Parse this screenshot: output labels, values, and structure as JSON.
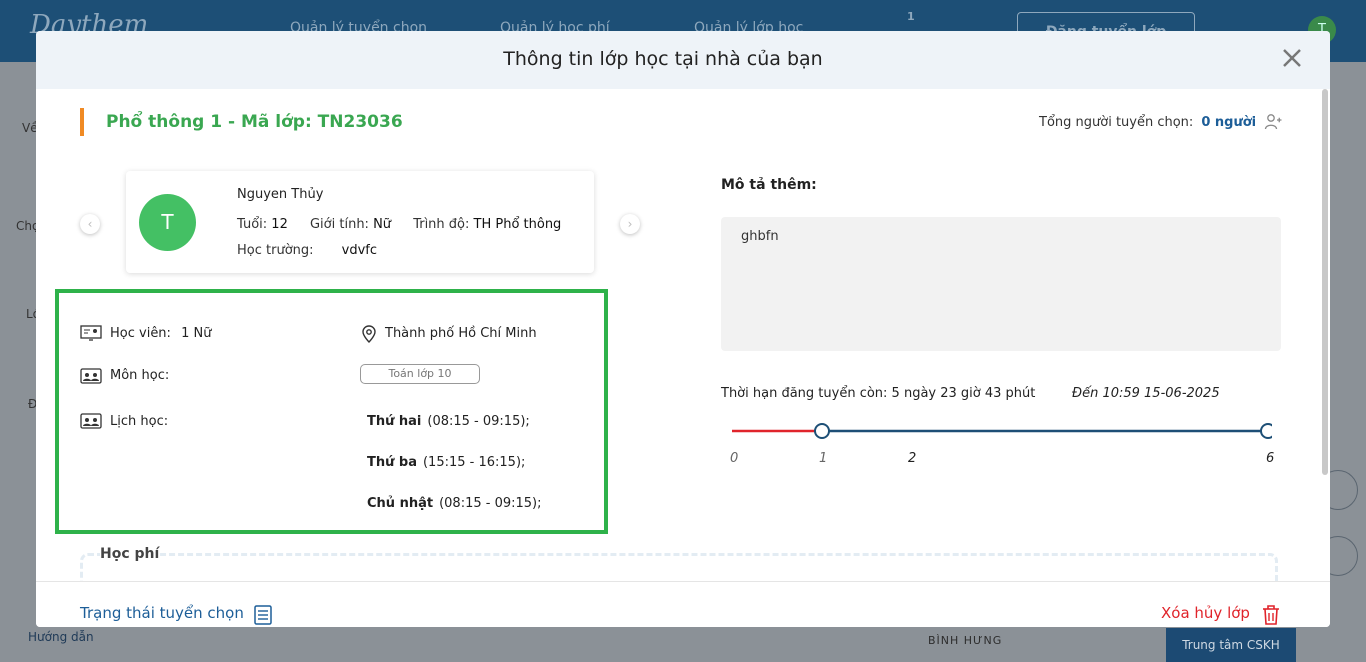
{
  "background": {
    "logo": "Daythem",
    "nav": [
      "Quản lý tuyển chọn",
      "Quản lý học phí",
      "Quản lý lớp học"
    ],
    "notification_count": "1",
    "post_button": "Đăng tuyển lớp",
    "user_initial": "T",
    "side_labels": [
      "Về",
      "Chọ",
      "Lớ",
      "Đ"
    ],
    "help": "Hướng dẫn",
    "map_label": "BÌNH HƯNG",
    "cskh": "Trung tâm CSKH"
  },
  "modal": {
    "title": "Thông tin lớp học tại nhà của bạn",
    "class_title": "Phổ thông 1 - Mã lớp: TN23036",
    "applicants_label": "Tổng người tuyển chọn:",
    "applicants_count": "0 người",
    "student": {
      "initial": "T",
      "name": "Nguyen Thủy",
      "age_label": "Tuổi:",
      "age": "12",
      "gender_label": "Giới tính:",
      "gender": "Nữ",
      "level_label": "Trình độ:",
      "level": "TH Phổ thông",
      "school_label": "Học trường:",
      "school": "vdvfc"
    },
    "details": {
      "students_label": "Học viên:",
      "students_value": "1 Nữ",
      "location": "Thành phố Hồ Chí Minh",
      "subject_label": "Môn học:",
      "subject_tag": "Toán lớp 10",
      "schedule_label": "Lịch học:",
      "schedule": [
        {
          "day": "Thứ hai",
          "time": "(08:15 - 09:15);"
        },
        {
          "day": "Thứ ba",
          "time": "(15:15 - 16:15);"
        },
        {
          "day": "Chủ nhật",
          "time": "(08:15 - 09:15);"
        }
      ]
    },
    "fee_label": "Học phí",
    "description_title": "Mô tả thêm:",
    "description": "ghbfn",
    "deadline_text": "Thời hạn đăng tuyển còn: 5 ngày 23 giờ 43 phút",
    "deadline_date": "Đến 10:59 15-06-2025",
    "timeline_ticks": [
      "0",
      "1",
      "2",
      "6"
    ],
    "timeline_progress_days": 1,
    "timeline_total_days": 6,
    "status_link": "Trạng thái tuyển chọn",
    "delete_link": "Xóa hủy lớp",
    "colors": {
      "primary": "#1d5e98",
      "success": "#3aa751",
      "danger": "#e0242b",
      "accent": "#f08a24"
    }
  }
}
